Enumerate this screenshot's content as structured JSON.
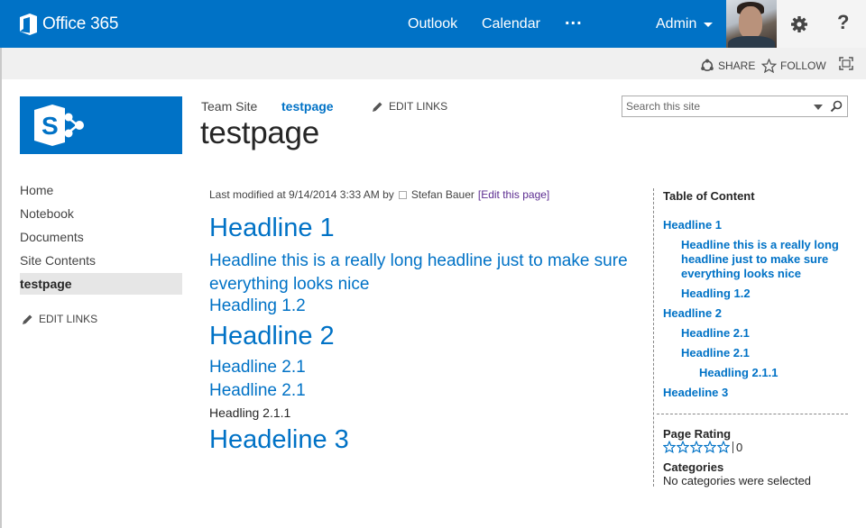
{
  "suite_bar": {
    "brand": "Office 365",
    "links": [
      "Outlook",
      "Calendar"
    ],
    "more": "...",
    "user": "Admin"
  },
  "ribbon": {
    "share": "SHARE",
    "follow": "FOLLOW"
  },
  "header": {
    "breadcrumb_root": "Team Site",
    "breadcrumb_current": "testpage",
    "edit_links": "EDIT LINKS",
    "page_title": "testpage",
    "search_placeholder": "Search this site"
  },
  "quick_launch": {
    "items": [
      "Home",
      "Notebook",
      "Documents",
      "Site Contents"
    ],
    "selected": "testpage",
    "edit_links": "EDIT LINKS"
  },
  "content": {
    "modified_prefix": "Last modified at 9/14/2014 3:33 AM by",
    "modified_by": "Stefan Bauer",
    "edit_page": "[Edit this page]",
    "headings": [
      "Headline 1",
      "Headline this is a really long headline just to make sure everything looks nice",
      "Headling 1.2",
      "Headline 2",
      "Headline 2.1",
      "Headline 2.1",
      "Headling 2.1.1",
      "Headeline 3"
    ]
  },
  "toc": {
    "title": "Table of Content",
    "items": [
      "Headline 1",
      "Headline this is a really long headline just to make sure everything looks nice",
      "Headling 1.2",
      "Headline 2",
      "Headline 2.1",
      "Headline 2.1",
      "Headling 2.1.1",
      "Headeline 3"
    ]
  },
  "rating": {
    "title": "Page Rating",
    "stars": 0,
    "max_stars": 5,
    "count": "0"
  },
  "categories": {
    "title": "Categories",
    "value": "No categories were selected"
  },
  "colors": {
    "brand_blue": "#0072c6",
    "link_purple": "#5c2d91"
  },
  "icons": [
    "office-logo-icon",
    "gear-icon",
    "help-icon",
    "share-icon",
    "follow-star-icon",
    "focus-content-icon",
    "sharepoint-logo-icon",
    "pencil-icon",
    "search-icon",
    "presence-icon",
    "star-icon"
  ]
}
